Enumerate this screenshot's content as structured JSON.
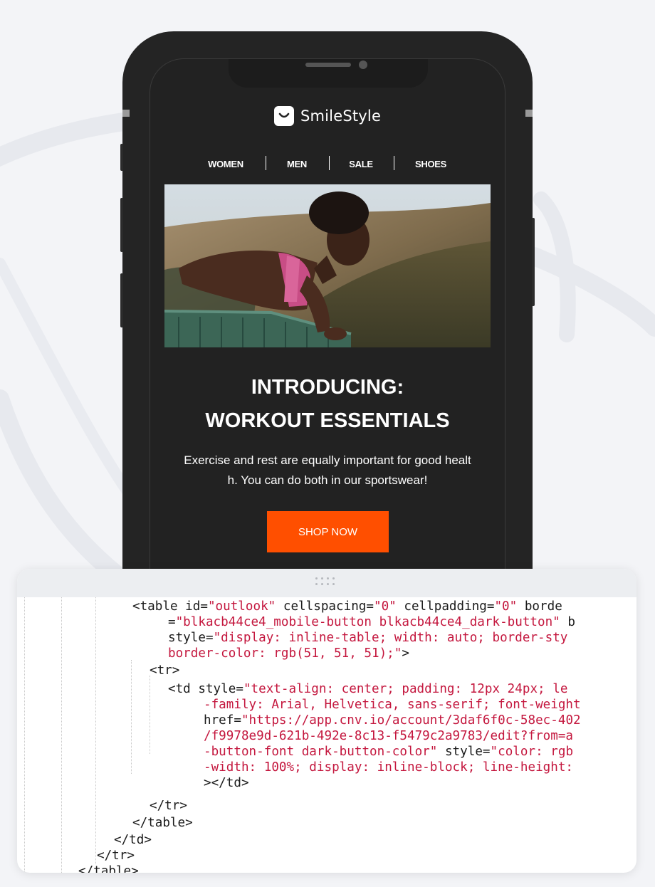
{
  "email": {
    "brand": "SmileStyle",
    "nav": [
      "WOMEN",
      "MEN",
      "SALE",
      "SHOES"
    ],
    "headline": [
      "INTRODUCING:",
      "WORKOUT ESSENTIALS"
    ],
    "body": "Exercise and rest are equally important for good health. You can do both in our sportswear!",
    "cta": "SHOP NOW"
  },
  "colors": {
    "phone_body": "#242424",
    "cta": "#ff4f00",
    "code_string": "#c4173e",
    "background": "#f3f4f7"
  },
  "code": {
    "lines": [
      [
        {
          "t": "<table id="
        },
        {
          "t": "\"outlook\"",
          "s": 1
        },
        {
          "t": " cellspacing="
        },
        {
          "t": "\"0\"",
          "s": 1
        },
        {
          "t": " cellpadding="
        },
        {
          "t": "\"0\"",
          "s": 1
        },
        {
          "t": " borde"
        }
      ],
      [
        {
          "t": "="
        },
        {
          "t": "\"blkacb44ce4_mobile-button blkacb44ce4_dark-button\"",
          "s": 1
        },
        {
          "t": " b"
        }
      ],
      [
        {
          "t": "style="
        },
        {
          "t": "\"display: inline-table; width: auto; border-sty",
          "s": 1
        }
      ],
      [
        {
          "t": "border-color: rgb(51, 51, 51);\"",
          "s": 1
        },
        {
          "t": ">"
        }
      ],
      [
        {
          "t": "<tr>"
        }
      ],
      [
        {
          "t": "<td style="
        },
        {
          "t": "\"text-align: center; padding: 12px 24px; le",
          "s": 1
        }
      ],
      [
        {
          "t": "-family: Arial, Helvetica, sans-serif; font-weight",
          "s": 1
        }
      ],
      [
        {
          "t": "href="
        },
        {
          "t": "\"https://app.cnv.io/account/3daf6f0c-58ec-402",
          "s": 1
        }
      ],
      [
        {
          "t": "/f9978e9d-621b-492e-8c13-f5479c2a9783/edit?from=a",
          "s": 1
        }
      ],
      [
        {
          "t": "-button-font dark-button-color\"",
          "s": 1
        },
        {
          "t": " style="
        },
        {
          "t": "\"color: rgb",
          "s": 1
        }
      ],
      [
        {
          "t": "-width: 100%; display: inline-block; line-height:",
          "s": 1
        }
      ],
      [
        {
          "t": "></td>"
        }
      ],
      [
        {
          "t": "</tr>"
        }
      ],
      [
        {
          "t": "</table>"
        }
      ],
      [
        {
          "t": "</td>"
        }
      ],
      [
        {
          "t": "</tr>"
        }
      ],
      [
        {
          "t": "</table>"
        }
      ]
    ]
  }
}
